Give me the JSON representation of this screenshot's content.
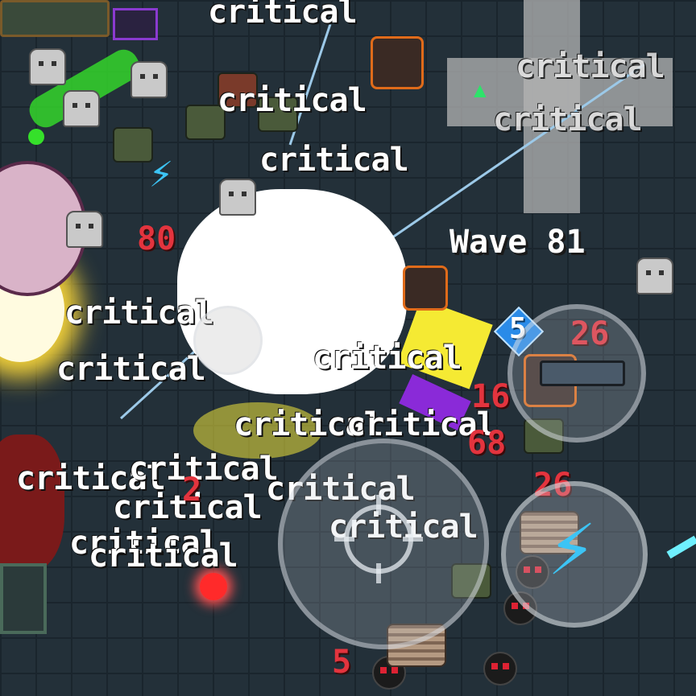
{
  "hud": {
    "wave_label": "Wave 81",
    "wave_badge": "5",
    "skill_icon": "lightning-bolt-icon",
    "aim_icon": "crosshair-icon"
  },
  "floating_text": {
    "critical": "critical",
    "dmg_80": "80",
    "dmg_26_a": "26",
    "dmg_26_b": "26",
    "dmg_16": "16",
    "dmg_68": "68",
    "dmg_5": "5",
    "dmg_2": "2"
  },
  "colors": {
    "critical_text": "#ffffff",
    "damage_text": "#e3343e",
    "wave_text": "#ffffff",
    "badge": "#2a8be8",
    "lightning": "#3cc4f5",
    "floor": "#233039"
  }
}
